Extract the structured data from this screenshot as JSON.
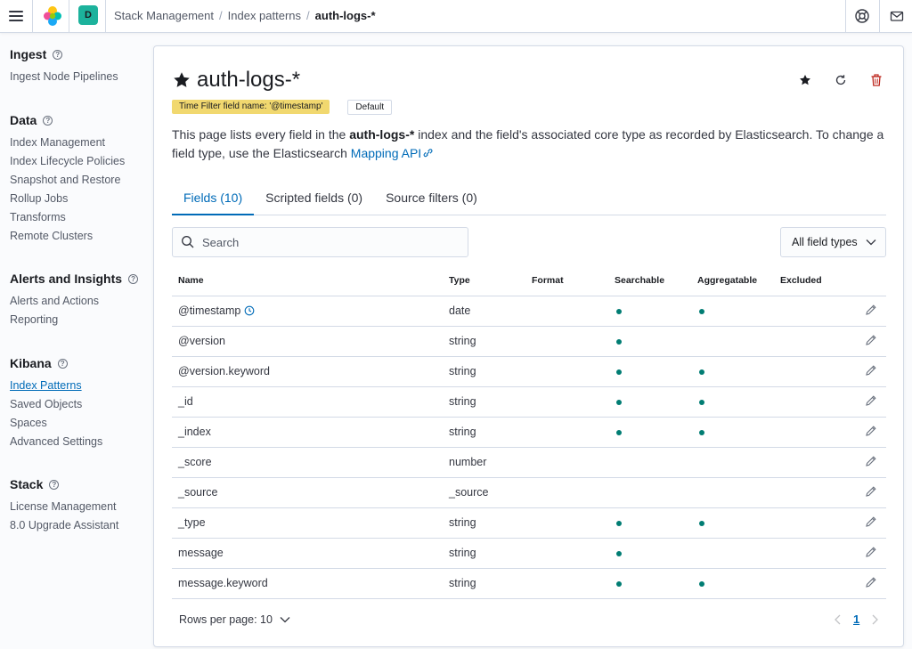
{
  "header": {
    "space_initial": "D",
    "breadcrumbs": [
      "Stack Management",
      "Index patterns",
      "auth-logs-*"
    ]
  },
  "sidebar": {
    "groups": [
      {
        "title": "Ingest",
        "items": [
          "Ingest Node Pipelines"
        ]
      },
      {
        "title": "Data",
        "items": [
          "Index Management",
          "Index Lifecycle Policies",
          "Snapshot and Restore",
          "Rollup Jobs",
          "Transforms",
          "Remote Clusters"
        ]
      },
      {
        "title": "Alerts and Insights",
        "items": [
          "Alerts and Actions",
          "Reporting"
        ]
      },
      {
        "title": "Kibana",
        "items": [
          "Index Patterns",
          "Saved Objects",
          "Spaces",
          "Advanced Settings"
        ]
      },
      {
        "title": "Stack",
        "items": [
          "License Management",
          "8.0 Upgrade Assistant"
        ]
      }
    ],
    "active_item": "Index Patterns"
  },
  "page": {
    "title": "auth-logs-*",
    "time_filter_badge": "Time Filter field name: '@timestamp'",
    "default_badge": "Default",
    "desc_part1": "This page lists every field in the ",
    "desc_bold": "auth-logs-*",
    "desc_part2": " index and the field's associated core type as recorded by Elasticsearch. To change a field type, use the Elasticsearch ",
    "desc_link": "Mapping API"
  },
  "tabs": [
    "Fields (10)",
    "Scripted fields (0)",
    "Source filters (0)"
  ],
  "search": {
    "placeholder": "Search"
  },
  "type_filter": {
    "label": "All field types"
  },
  "table": {
    "columns": [
      "Name",
      "Type",
      "Format",
      "Searchable",
      "Aggregatable",
      "Excluded"
    ],
    "rows": [
      {
        "name": "@timestamp",
        "type": "date",
        "format": "",
        "searchable": true,
        "aggregatable": true,
        "excluded": false,
        "time_field": true
      },
      {
        "name": "@version",
        "type": "string",
        "format": "",
        "searchable": true,
        "aggregatable": false,
        "excluded": false
      },
      {
        "name": "@version.keyword",
        "type": "string",
        "format": "",
        "searchable": true,
        "aggregatable": true,
        "excluded": false
      },
      {
        "name": "_id",
        "type": "string",
        "format": "",
        "searchable": true,
        "aggregatable": true,
        "excluded": false
      },
      {
        "name": "_index",
        "type": "string",
        "format": "",
        "searchable": true,
        "aggregatable": true,
        "excluded": false
      },
      {
        "name": "_score",
        "type": "number",
        "format": "",
        "searchable": false,
        "aggregatable": false,
        "excluded": false
      },
      {
        "name": "_source",
        "type": "_source",
        "format": "",
        "searchable": false,
        "aggregatable": false,
        "excluded": false
      },
      {
        "name": "_type",
        "type": "string",
        "format": "",
        "searchable": true,
        "aggregatable": true,
        "excluded": false
      },
      {
        "name": "message",
        "type": "string",
        "format": "",
        "searchable": true,
        "aggregatable": false,
        "excluded": false
      },
      {
        "name": "message.keyword",
        "type": "string",
        "format": "",
        "searchable": true,
        "aggregatable": true,
        "excluded": false
      }
    ]
  },
  "pagination": {
    "rows_per_page": "Rows per page: 10",
    "current_page": "1"
  },
  "colors": {
    "accent": "#006bb8",
    "dot": "#017d73",
    "warning_badge": "#f1d86f",
    "delete": "#bd271e"
  }
}
